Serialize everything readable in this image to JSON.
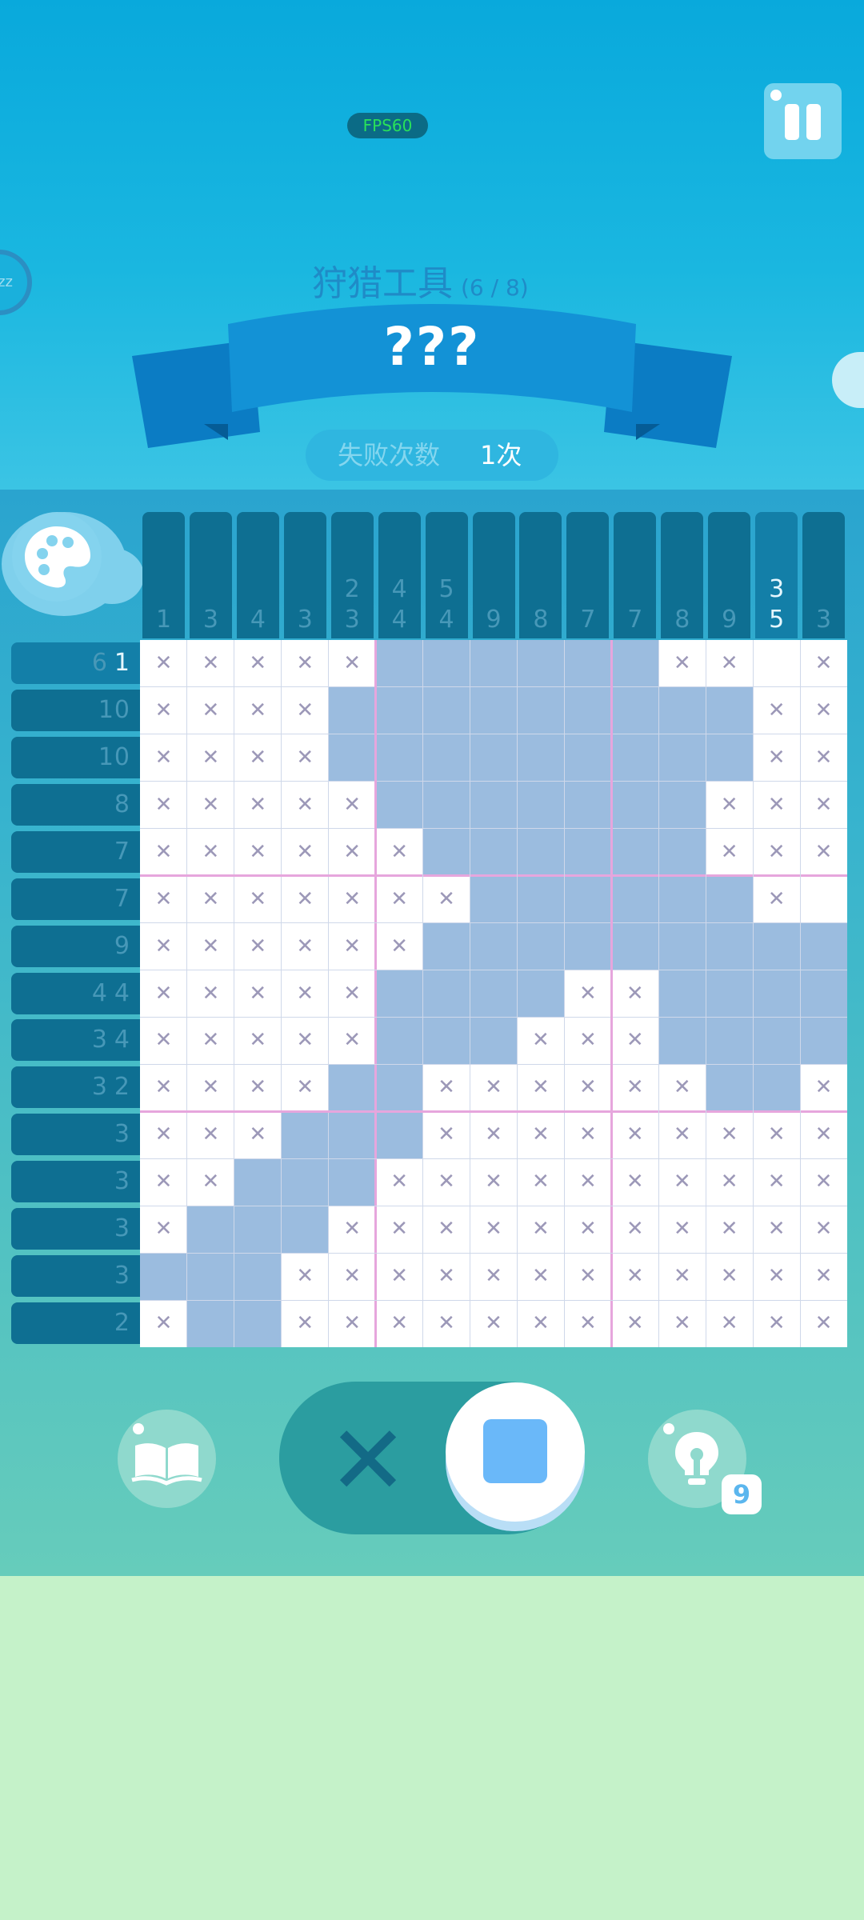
{
  "hud": {
    "fps": "FPS60",
    "pause_icon": "pause-icon",
    "left_badge": "zz"
  },
  "level": {
    "title": "狩猎工具",
    "progress": "(6 / 8)",
    "puzzle_name": "???",
    "fail_label": "失败次数",
    "fail_count": "1次"
  },
  "clues": {
    "columns": [
      [
        "1"
      ],
      [
        "3"
      ],
      [
        "4"
      ],
      [
        "3"
      ],
      [
        "2",
        "3"
      ],
      [
        "4",
        "4"
      ],
      [
        "5",
        "4"
      ],
      [
        "9"
      ],
      [
        "8"
      ],
      [
        "7"
      ],
      [
        "7"
      ],
      [
        "8"
      ],
      [
        "9"
      ],
      [
        "3",
        "5"
      ],
      [
        "3"
      ]
    ],
    "active_column": 13,
    "rows": [
      [
        "6",
        "1"
      ],
      [
        "10"
      ],
      [
        "10"
      ],
      [
        "8"
      ],
      [
        "7"
      ],
      [
        "7"
      ],
      [
        "9"
      ],
      [
        "4",
        "4"
      ],
      [
        "3",
        "4"
      ],
      [
        "3",
        "2"
      ],
      [
        "3"
      ],
      [
        "3"
      ],
      [
        "3"
      ],
      [
        "3"
      ],
      [
        "2"
      ]
    ],
    "active_row": 0,
    "completed_row_numbers": [
      [
        0,
        1
      ]
    ]
  },
  "grid": {
    "size": 15,
    "legend": "f = filled, x = crossed, . = empty",
    "rows": [
      "xxxxxffffffxx.x",
      "xxxxfffffffffxx",
      "xxxxfffffffffxx",
      "xxxxxfffffffxxx",
      "xxxxxxffffffxxx",
      "xxxxxxxffffffx.",
      "xxxxxxfffffffff",
      "xxxxxffffxxffff",
      "xxxxxfffxxxffff",
      "xxxxffxxxxxxffx",
      "xxxfffxxxxxxxxx",
      "xxfffxxxxxxxxxx",
      "xfffxxxxxxxxxxx",
      "fffxxxxxxxxxxxx",
      "xffxxxxxxxxxxxx"
    ],
    "colors": {
      "filled": "#9bbcdf",
      "empty": "#ffffff",
      "cross": "#9c98b8"
    }
  },
  "controls": {
    "book_icon": "book-icon",
    "cross_mode_glyph": "✕",
    "fill_mode_icon": "square-icon",
    "hint_icon": "lightbulb-icon",
    "hint_count": "9"
  }
}
